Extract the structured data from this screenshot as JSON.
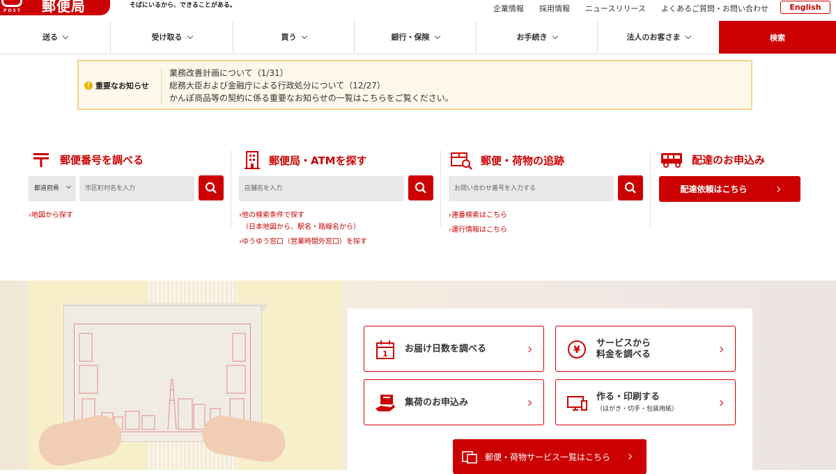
{
  "header": {
    "logo_name": "郵便局",
    "logo_sub": "POST",
    "tagline": "そばにいるから、できることがある。",
    "links": [
      "企業情報",
      "採用情報",
      "ニュースリリース",
      "よくあるご質問・お問い合わせ"
    ],
    "english_label": "English"
  },
  "nav": {
    "items": [
      "送る",
      "受け取る",
      "買う",
      "銀行・保険",
      "お手続き",
      "法人のお客さま"
    ],
    "search_label": "検索"
  },
  "notice": {
    "label": "重要なお知らせ",
    "icon": "exclamation-icon",
    "lines": [
      "業務改善計画について（1/31）",
      "総務大臣および金融庁による行政処分について（12/27）",
      "かんぽ商品等の契約に係る重要なお知らせの一覧はこちらをご覧ください。"
    ]
  },
  "postal_code": {
    "title": "郵便番号を調べる",
    "prefecture": "都道府県",
    "city_placeholder": "市区町村名を入力",
    "links": [
      "地図から探す"
    ]
  },
  "find_office": {
    "title": "郵便局・ATMを探す",
    "placeholder": "店舗名を入力",
    "links": [
      "他の検索条件で探す",
      "（日本地図から、駅名・路線名から）",
      "ゆうゆう窓口（営業時間外窓口）を探す"
    ]
  },
  "tracking": {
    "title": "郵便・荷物の追跡",
    "placeholder": "お問い合わせ番号を入力する",
    "links": [
      "連番検索はこちら",
      "運行情報はこちら"
    ]
  },
  "delivery": {
    "title": "配達のお申込み",
    "button_label": "配達依頼はこちら"
  },
  "services": {
    "cards": [
      {
        "label": "お届け日数を調べる",
        "icon": "calendar-icon"
      },
      {
        "label": "サービスから",
        "label2": "料金を調べる",
        "icon": "yen-icon"
      },
      {
        "label": "集荷のお申込み",
        "icon": "pickup-icon"
      },
      {
        "label": "作る・印刷する",
        "sub": "（はがき・切手・包装用紙）",
        "icon": "print-icon"
      }
    ],
    "all_services_label": "郵便・荷物サービス一覧はこちら"
  },
  "colors": {
    "brand": "#cc0000",
    "notice_bg": "#fdf8ea",
    "notice_border": "#f0d58a"
  }
}
